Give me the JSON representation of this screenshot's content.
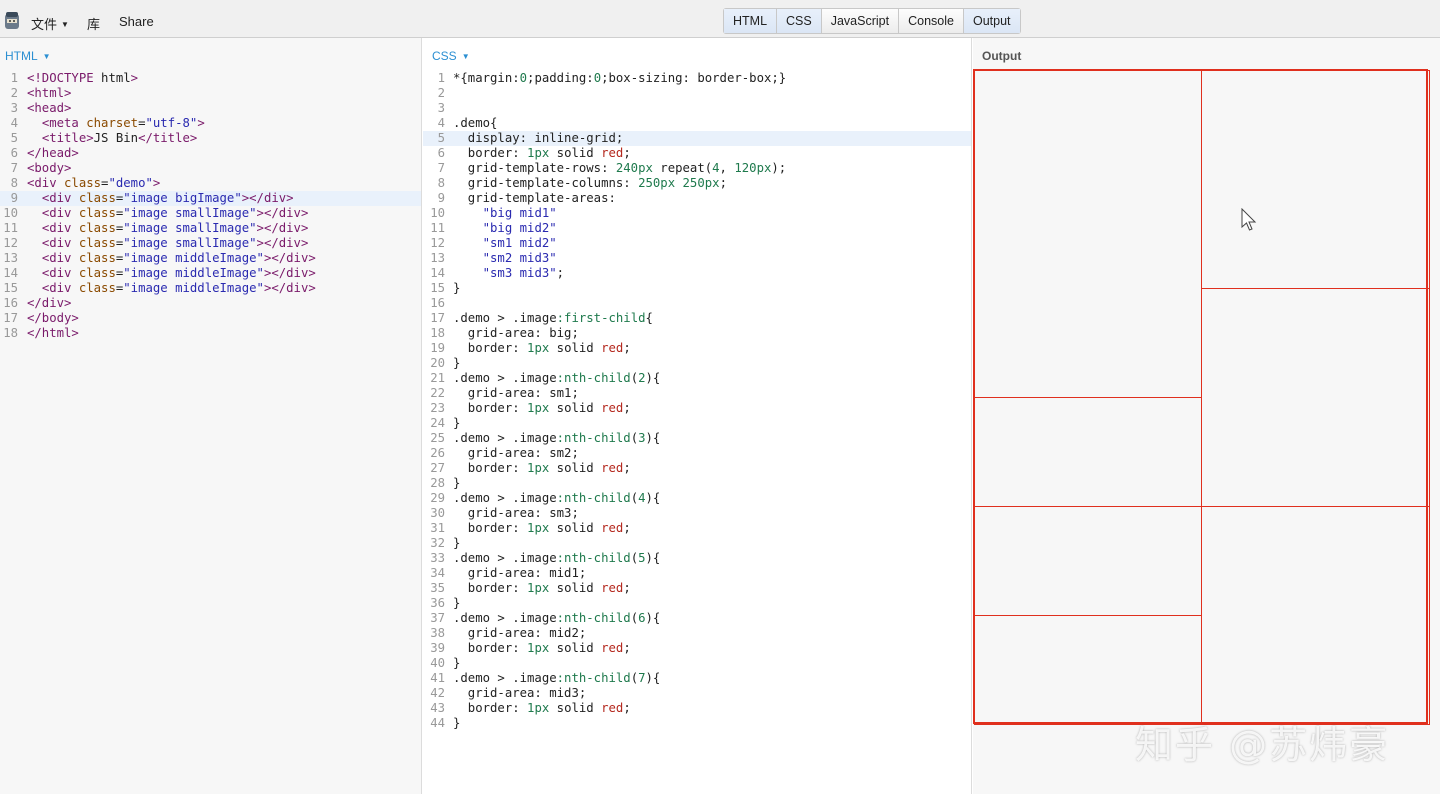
{
  "topbar": {
    "menu": [
      "文件",
      "库",
      "Share"
    ],
    "tabs": [
      "HTML",
      "CSS",
      "JavaScript",
      "Console",
      "Output"
    ]
  },
  "panels": {
    "html_label": "HTML",
    "css_label": "CSS",
    "output_label": "Output"
  },
  "html_code": [
    "<!DOCTYPE html>",
    "<html>",
    "<head>",
    "  <meta charset=\"utf-8\">",
    "  <title>JS Bin</title>",
    "</head>",
    "<body>",
    "<div class=\"demo\">",
    "  <div class=\"image bigImage\"></div>",
    "  <div class=\"image smallImage\"></div>",
    "  <div class=\"image smallImage\"></div>",
    "  <div class=\"image smallImage\"></div>",
    "  <div class=\"image middleImage\"></div>",
    "  <div class=\"image middleImage\"></div>",
    "  <div class=\"image middleImage\"></div>",
    "</div>",
    "</body>",
    "</html>"
  ],
  "css_code": [
    "*{margin:0;padding:0;box-sizing: border-box;}",
    "",
    "",
    ".demo{",
    "  display: inline-grid;",
    "  border: 1px solid red;",
    "  grid-template-rows: 240px repeat(4, 120px);",
    "  grid-template-columns: 250px 250px;",
    "  grid-template-areas:",
    "    \"big mid1\"",
    "    \"big mid2\"",
    "    \"sm1 mid2\"",
    "    \"sm2 mid3\"",
    "    \"sm3 mid3\";",
    "}",
    "",
    ".demo > .image:first-child{",
    "  grid-area: big;",
    "  border: 1px solid red;",
    "}",
    ".demo > .image:nth-child(2){",
    "  grid-area: sm1;",
    "  border: 1px solid red;",
    "}",
    ".demo > .image:nth-child(3){",
    "  grid-area: sm2;",
    "  border: 1px solid red;",
    "}",
    ".demo > .image:nth-child(4){",
    "  grid-area: sm3;",
    "  border: 1px solid red;",
    "}",
    ".demo > .image:nth-child(5){",
    "  grid-area: mid1;",
    "  border: 1px solid red;",
    "}",
    ".demo > .image:nth-child(6){",
    "  grid-area: mid2;",
    "  border: 1px solid red;",
    "}",
    ".demo > .image:nth-child(7){",
    "  grid-area: mid3;",
    "  border: 1px solid red;",
    "}"
  ],
  "watermark": "知乎 @苏炜豪",
  "colors": {
    "accent": "#2b8fd2",
    "grid_border": "#e0301e"
  }
}
